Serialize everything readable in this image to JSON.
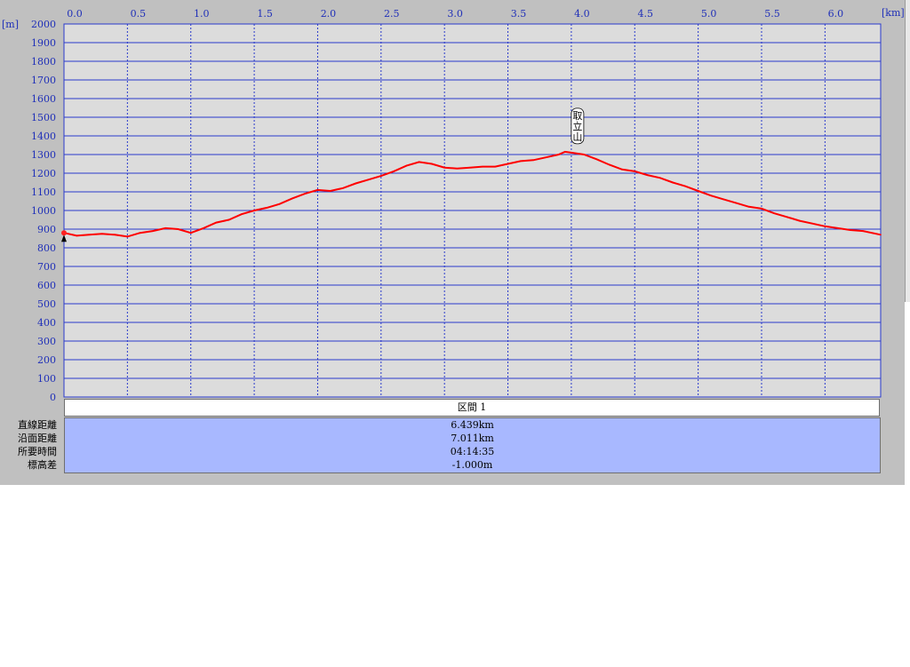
{
  "chart_data": {
    "type": "line",
    "x_unit": "[km]",
    "y_unit": "[m]",
    "xlim": [
      0.0,
      6.439
    ],
    "ylim": [
      0,
      2000
    ],
    "x_ticks": [
      "0.0",
      "0.5",
      "1.0",
      "1.5",
      "2.0",
      "2.5",
      "3.0",
      "3.5",
      "4.0",
      "4.5",
      "5.0",
      "5.5",
      "6.0"
    ],
    "y_ticks": [
      "2000",
      "1900",
      "1800",
      "1700",
      "1600",
      "1500",
      "1400",
      "1300",
      "1200",
      "1100",
      "1000",
      "900",
      "800",
      "700",
      "600",
      "500",
      "400",
      "300",
      "200",
      "100",
      "0"
    ],
    "series": [
      {
        "color": "#ff0000",
        "x": [
          0.0,
          0.1,
          0.2,
          0.3,
          0.4,
          0.5,
          0.6,
          0.7,
          0.8,
          0.9,
          1.0,
          1.1,
          1.2,
          1.3,
          1.4,
          1.5,
          1.6,
          1.7,
          1.8,
          1.9,
          2.0,
          2.1,
          2.2,
          2.3,
          2.4,
          2.5,
          2.6,
          2.7,
          2.8,
          2.9,
          3.0,
          3.1,
          3.2,
          3.3,
          3.4,
          3.5,
          3.6,
          3.7,
          3.8,
          3.9,
          3.95,
          4.0,
          4.1,
          4.2,
          4.3,
          4.4,
          4.5,
          4.6,
          4.7,
          4.8,
          4.9,
          5.0,
          5.1,
          5.2,
          5.3,
          5.4,
          5.5,
          5.6,
          5.7,
          5.8,
          5.9,
          6.0,
          6.1,
          6.2,
          6.3,
          6.439
        ],
        "y": [
          880,
          865,
          870,
          875,
          870,
          860,
          880,
          890,
          905,
          900,
          880,
          905,
          935,
          950,
          980,
          1000,
          1015,
          1035,
          1065,
          1090,
          1110,
          1105,
          1120,
          1145,
          1165,
          1185,
          1210,
          1240,
          1260,
          1250,
          1230,
          1225,
          1230,
          1235,
          1235,
          1250,
          1265,
          1270,
          1285,
          1300,
          1315,
          1310,
          1300,
          1275,
          1245,
          1220,
          1210,
          1190,
          1175,
          1150,
          1130,
          1105,
          1080,
          1060,
          1040,
          1020,
          1010,
          985,
          965,
          945,
          930,
          915,
          905,
          895,
          890,
          870
        ]
      }
    ],
    "annotations": [
      {
        "label": "取立山",
        "x": 4.0,
        "y": 1315
      }
    ],
    "start_marker": {
      "x": 0.0,
      "y": 880
    },
    "grid": true
  },
  "segment": {
    "header": "区間 1",
    "rows": [
      {
        "label": "直線距離",
        "value": "6.439km"
      },
      {
        "label": "沿面距離",
        "value": "7.011km"
      },
      {
        "label": "所要時間",
        "value": "04:14:35"
      },
      {
        "label": "標高差",
        "value": "-1.000m"
      }
    ]
  }
}
